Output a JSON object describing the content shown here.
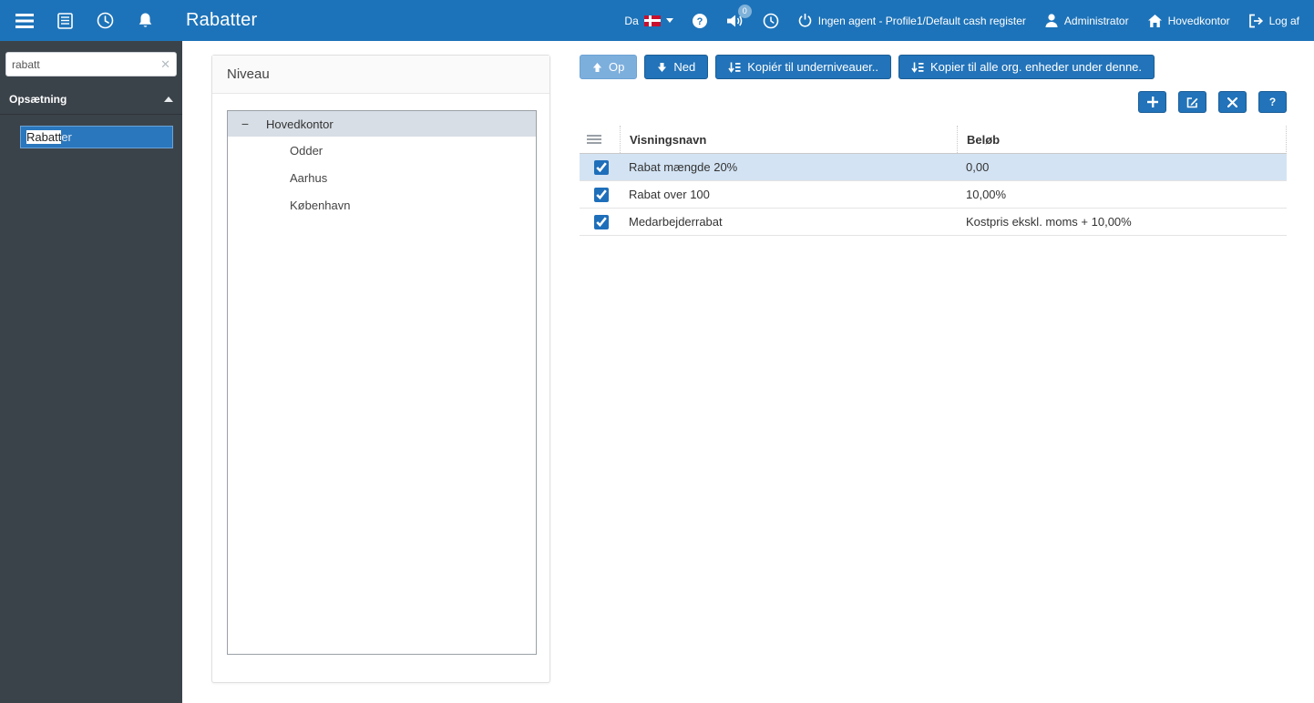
{
  "colors": {
    "accent": "#1e73b8",
    "topbar_bg": "#1d73b9",
    "sidebar_bg": "#3b434a",
    "selected_row_bg": "#d3e3f3"
  },
  "icons": {
    "menu": "hamburger",
    "journal": "ledger-page",
    "clock": "clock",
    "bell": "bell",
    "help": "question-circle",
    "volume": "speaker",
    "power": "power",
    "user": "person",
    "home": "house",
    "logout": "exit-arrow",
    "search_clear": "✕",
    "section_collapse": "▲",
    "tree_collapse": "−",
    "arrow_up": "up-arrow",
    "arrow_down": "down-arrow",
    "copy": "sort-lines",
    "add": "+",
    "edit": "pencil-square",
    "delete": "✕",
    "table_header": "list-lines"
  },
  "topbar": {
    "title": "Rabatter",
    "language": "Da",
    "notification_count": "0",
    "agent": "Ingen agent - Profile1/Default cash register",
    "user": "Administrator",
    "organization": "Hovedkontor",
    "logout": "Log af"
  },
  "sidebar": {
    "search_value": "rabatt",
    "section_label": "Opsætning",
    "selected_item_match": "Rabatt",
    "selected_item_rest": "er"
  },
  "niveau": {
    "title": "Niveau",
    "root_label": "Hovedkontor",
    "children": [
      "Odder",
      "Aarhus",
      "København"
    ]
  },
  "toolbar": {
    "up_label": "Op",
    "down_label": "Ned",
    "copy_sublevels_label": "Kopiér til underniveauer..",
    "copy_all_label": "Kopier til alle org. enheder under denne.",
    "help_label": "?"
  },
  "table": {
    "col_name": "Visningsnavn",
    "col_amount": "Beløb",
    "rows": [
      {
        "name": "Rabat mængde 20%",
        "amount": "0,00",
        "checked": true
      },
      {
        "name": "Rabat over 100",
        "amount": "10,00%",
        "checked": true
      },
      {
        "name": "Medarbejderrabat",
        "amount": "Kostpris ekskl. moms + 10,00%",
        "checked": true
      }
    ]
  }
}
